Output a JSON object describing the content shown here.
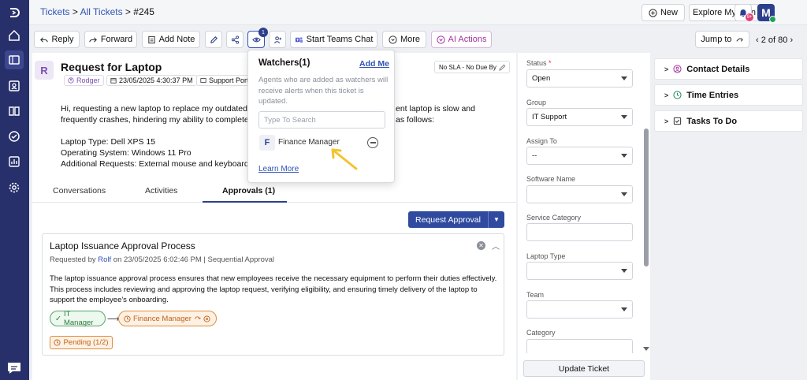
{
  "sidebar": {
    "icons": [
      "logo-icon",
      "home-icon",
      "tickets-icon",
      "contacts-icon",
      "knowledge-base-icon",
      "tasks-icon",
      "reports-icon",
      "settings-icon"
    ],
    "chat_icon": "chat-icon"
  },
  "topbar": {
    "crumb_tickets": "Tickets",
    "sep1": " > ",
    "crumb_all": "All Tickets",
    "sep2": " > ",
    "crumb_id": "#245",
    "new_label": "New",
    "plan_label": "Explore My Plan",
    "notif_badge": "9+",
    "avatar_letter": "M"
  },
  "actions": {
    "reply": "Reply",
    "forward": "Forward",
    "add_note": "Add Note",
    "watchers_count": "1",
    "teams": "Start Teams Chat",
    "more": "More",
    "ai": "AI Actions",
    "jump": "Jump to",
    "pager": "2 of 80"
  },
  "ticket": {
    "avatar_letter": "R",
    "title": "Request for Laptop",
    "requester": "Rodger",
    "date": "23/05/2025 4:30:37 PM",
    "portal": "Support Porta",
    "sla": "No SLA - No Due By",
    "body_lines": [
      "Hi, requesting a new laptop to replace my outdated device",
      "frequently crashes, hindering my ability to complete proje",
      "",
      "Laptop Type: Dell XPS 15",
      "Operating System: Windows 11 Pro",
      "Additional Requests: External mouse and keyboard"
    ],
    "body_right_1": "ent laptop is slow and",
    "body_right_2": "as follows:"
  },
  "tabs": {
    "conversations": "Conversations",
    "activities": "Activities",
    "approvals": "Approvals (1)"
  },
  "approval": {
    "request_btn": "Request Approval",
    "title": "Laptop Issuance Approval Process",
    "requested_by_prefix": "Requested by ",
    "requested_by": "Rolf",
    "requested_suffix": " on 23/05/2025 6:02:46 PM | Sequential Approval",
    "desc": "The laptop issuance approval process ensures that new employees receive the necessary equipment to perform their duties effectively. This process includes reviewing and approving the laptop request, verifying eligibility, and ensuring timely delivery of the laptop to support the employee's onboarding.",
    "step1": "IT Manager",
    "step2": "Finance Manager",
    "status": "Pending (1/2)",
    "colors": {
      "approved": "#2c7a3f",
      "pending": "#c1631a"
    }
  },
  "watchers_popup": {
    "title": "Watchers(1)",
    "add_me": "Add Me",
    "desc": "Agents who are added as watchers will receive alerts when this ticket is updated.",
    "search_placeholder": "Type To Search",
    "watcher_letter": "F",
    "watcher_name": "Finance Manager",
    "learn_more": "Learn More"
  },
  "properties": {
    "status_label": "Status",
    "status_required": " *",
    "status_value": "Open",
    "group_label": "Group",
    "group_value": "IT Support",
    "assign_label": "Assign To",
    "assign_value": "--",
    "software_label": "Software Name",
    "software_value": "",
    "service_label": "Service Category",
    "laptop_label": "Laptop Type",
    "team_label": "Team",
    "category_label": "Category",
    "update_btn": "Update Ticket"
  },
  "side_panel": {
    "contact": "Contact Details",
    "time": "Time Entries",
    "tasks": "Tasks To Do"
  },
  "accent_color": "#2b3f8c"
}
